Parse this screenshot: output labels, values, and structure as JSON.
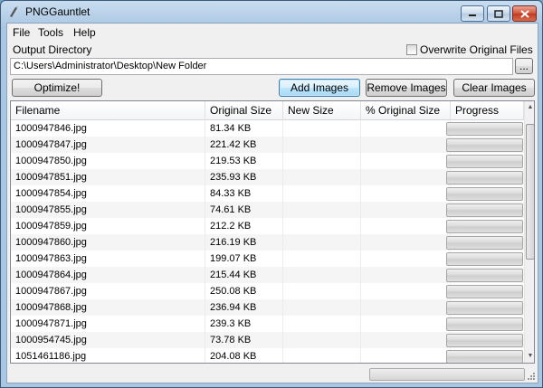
{
  "window": {
    "title": "PNGGauntlet"
  },
  "menu": [
    "File",
    "Tools",
    "Help"
  ],
  "output": {
    "label": "Output Directory",
    "path": "C:\\Users\\Administrator\\Desktop\\New Folder",
    "browse_label": "...",
    "overwrite_label": "Overwrite Original Files",
    "overwrite_checked": false
  },
  "buttons": {
    "optimize": "Optimize!",
    "add": "Add Images",
    "remove": "Remove Images",
    "clear": "Clear Images"
  },
  "table": {
    "columns": [
      "Filename",
      "Original Size",
      "New Size",
      "% Original Size",
      "Progress"
    ],
    "rows": [
      {
        "filename": "1000947846.jpg",
        "size": "81.34 KB"
      },
      {
        "filename": "1000947847.jpg",
        "size": "221.42 KB"
      },
      {
        "filename": "1000947850.jpg",
        "size": "219.53 KB"
      },
      {
        "filename": "1000947851.jpg",
        "size": "235.93 KB"
      },
      {
        "filename": "1000947854.jpg",
        "size": "84.33 KB"
      },
      {
        "filename": "1000947855.jpg",
        "size": "74.61 KB"
      },
      {
        "filename": "1000947859.jpg",
        "size": "212.2 KB"
      },
      {
        "filename": "1000947860.jpg",
        "size": "216.19 KB"
      },
      {
        "filename": "1000947863.jpg",
        "size": "199.07 KB"
      },
      {
        "filename": "1000947864.jpg",
        "size": "215.44 KB"
      },
      {
        "filename": "1000947867.jpg",
        "size": "250.08 KB"
      },
      {
        "filename": "1000947868.jpg",
        "size": "236.94 KB"
      },
      {
        "filename": "1000947871.jpg",
        "size": "239.3 KB"
      },
      {
        "filename": "1000954745.jpg",
        "size": "73.78 KB"
      },
      {
        "filename": "1051461186.jpg",
        "size": "204.08 KB"
      }
    ]
  }
}
